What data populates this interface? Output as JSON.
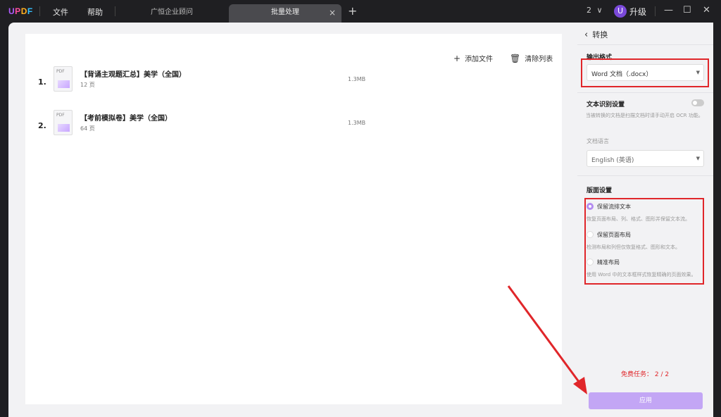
{
  "titlebar": {
    "logo": {
      "u": "U",
      "p": "P",
      "d": "D",
      "f": "F"
    },
    "menu": [
      "文件",
      "帮助"
    ],
    "tabs": [
      {
        "label": "广恒企业顾问",
        "active": false
      },
      {
        "label": "批量处理",
        "active": true
      }
    ],
    "tab_close": "×",
    "tab_add": "+",
    "counter": "2",
    "counter_chevron": "∨",
    "avatar_letter": "U",
    "upgrade_label": "升级",
    "window_buttons": {
      "minimize": "—",
      "maximize": "☐",
      "close": "✕"
    }
  },
  "actions": {
    "add_icon": "+",
    "add_label": "添加文件",
    "clear_icon": "🗑",
    "clear_label": "清除列表"
  },
  "files": [
    {
      "num": "1.",
      "name": "【背诵主观题汇总】美学（全国）",
      "pages": "12 页",
      "size": "1.3MB",
      "icon_text": "PDF"
    },
    {
      "num": "2.",
      "name": "【考前模拟卷】美学（全国）",
      "pages": "64 页",
      "size": "1.3MB",
      "icon_text": "PDF"
    }
  ],
  "side": {
    "back_icon": "‹",
    "back_label": "转换",
    "output_format_title": "输出格式",
    "output_format_value": "Word 文档（.docx）",
    "caret": "▼",
    "ocr_title": "文本识别设置",
    "ocr_hint": "当被转换的文档是扫描文档时请手动开启 OCR 功能。",
    "doc_lang_label": "文档语言",
    "doc_lang_value": "English (英语)",
    "layout_title": "版面设置",
    "layout_options": [
      {
        "label": "保留流排文本",
        "hint": "恢复页面布局、列、格式、图形并保留文本流。",
        "selected": true
      },
      {
        "label": "保留页面布局",
        "hint": "检测布局和列但仅恢复格式、图形和文本。",
        "selected": false
      },
      {
        "label": "精准布局",
        "hint": "使用 Word 中的文本框样式恢复精确的页面效果。",
        "selected": false
      }
    ],
    "free_tasks": "免费任务：  2 / 2",
    "apply_label": "应用"
  },
  "colors": {
    "accent": "#b38cf0",
    "apply_bg": "#c3a6f5",
    "highlight_red": "#e0262a"
  }
}
